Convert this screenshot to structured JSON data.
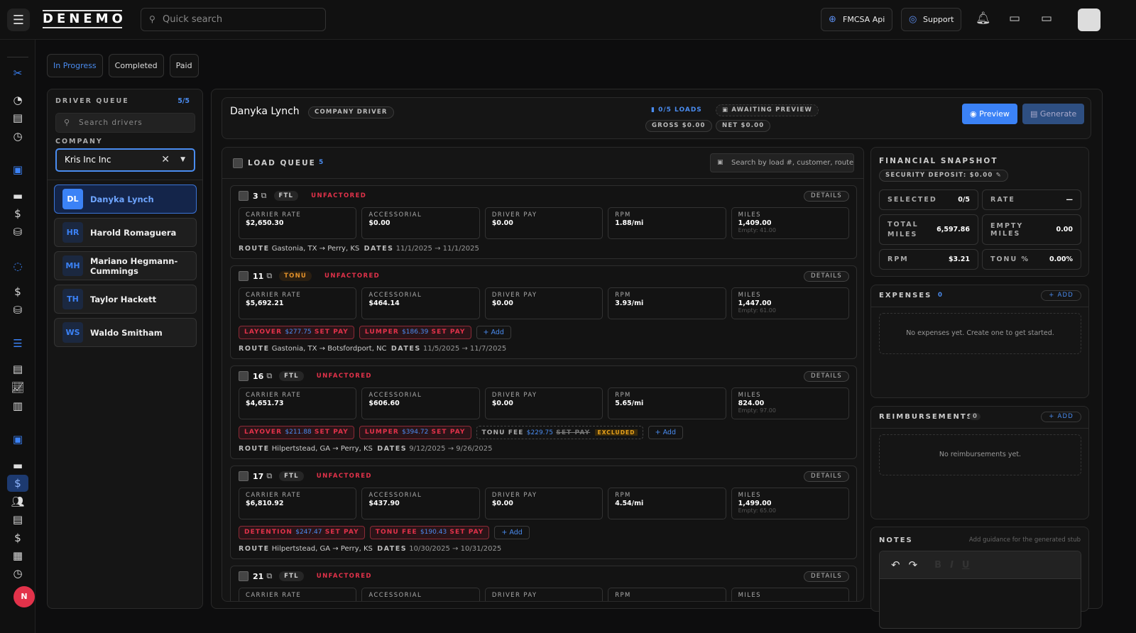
{
  "header": {
    "brand": "DENEMO",
    "search_placeholder": "Quick search",
    "fmcsa_label": "FMCSA Api",
    "support_label": "Support"
  },
  "tabs": [
    {
      "label": "In Progress",
      "active": true
    },
    {
      "label": "Completed",
      "active": false
    },
    {
      "label": "Paid",
      "active": false
    }
  ],
  "driver_queue": {
    "title": "DRIVER QUEUE",
    "count": "5/5",
    "search_placeholder": "Search drivers",
    "company_label": "COMPANY",
    "company_value": "Kris Inc Inc",
    "drivers": [
      {
        "initials": "DL",
        "name": "Danyka Lynch",
        "selected": true
      },
      {
        "initials": "HR",
        "name": "Harold Romaguera",
        "selected": false
      },
      {
        "initials": "MH",
        "name": "Mariano Hegmann-Cummings",
        "selected": false
      },
      {
        "initials": "TH",
        "name": "Taylor Hackett",
        "selected": false
      },
      {
        "initials": "WS",
        "name": "Waldo Smitham",
        "selected": false
      }
    ]
  },
  "driver_header": {
    "name": "Danyka Lynch",
    "role": "COMPANY DRIVER",
    "loads": "0/5 LOADS",
    "status": "AWAITING PREVIEW",
    "gross": "GROSS $0.00",
    "net": "NET $0.00",
    "preview_label": "Preview",
    "generate_label": "Generate"
  },
  "load_queue": {
    "title": "LOAD QUEUE",
    "count": "5",
    "search_placeholder": "Search by load #, customer, route",
    "details_label": "DETAILS",
    "add_label": "Add",
    "route_label": "ROUTE",
    "dates_label": "DATES",
    "metric_labels": [
      "CARRIER RATE",
      "ACCESSORIAL",
      "DRIVER PAY",
      "RPM",
      "MILES"
    ],
    "loads": [
      {
        "id": "3",
        "type": "FTL",
        "status": "UNFACTORED",
        "carrier_rate": "$2,650.30",
        "accessorial": "$0.00",
        "driver_pay": "$0.00",
        "rpm": "1.88/mi",
        "miles": "1,409.00",
        "empty": "Empty: 41.00",
        "chips": [],
        "route": "Gastonia, TX → Perry, KS",
        "dates": "11/1/2025 → 11/1/2025"
      },
      {
        "id": "11",
        "type": "TONU",
        "status": "UNFACTORED",
        "carrier_rate": "$5,692.21",
        "accessorial": "$464.14",
        "driver_pay": "$0.00",
        "rpm": "3.93/mi",
        "miles": "1,447.00",
        "empty": "Empty: 61.00",
        "chips": [
          {
            "name": "LAYOVER",
            "amount": "$277.75",
            "action": "SET PAY",
            "excluded": false
          },
          {
            "name": "LUMPER",
            "amount": "$186.39",
            "action": "SET PAY",
            "excluded": false
          }
        ],
        "route": "Gastonia, TX → Botsfordport, NC",
        "dates": "11/5/2025 → 11/7/2025"
      },
      {
        "id": "16",
        "type": "FTL",
        "status": "UNFACTORED",
        "carrier_rate": "$4,651.73",
        "accessorial": "$606.60",
        "driver_pay": "$0.00",
        "rpm": "5.65/mi",
        "miles": "824.00",
        "empty": "Empty: 97.00",
        "chips": [
          {
            "name": "LAYOVER",
            "amount": "$211.88",
            "action": "SET PAY",
            "excluded": false
          },
          {
            "name": "LUMPER",
            "amount": "$394.72",
            "action": "SET PAY",
            "excluded": false
          },
          {
            "name": "TONU FEE",
            "amount": "$229.75",
            "action": "SET PAY",
            "excluded": true,
            "badge": "EXCLUDED"
          }
        ],
        "route": "Hilpertstead, GA → Perry, KS",
        "dates": "9/12/2025 → 9/26/2025"
      },
      {
        "id": "17",
        "type": "FTL",
        "status": "UNFACTORED",
        "carrier_rate": "$6,810.92",
        "accessorial": "$437.90",
        "driver_pay": "$0.00",
        "rpm": "4.54/mi",
        "miles": "1,499.00",
        "empty": "Empty: 65.00",
        "chips": [
          {
            "name": "DETENTION",
            "amount": "$247.47",
            "action": "SET PAY",
            "excluded": false
          },
          {
            "name": "TONU FEE",
            "amount": "$190.43",
            "action": "SET PAY",
            "excluded": false
          }
        ],
        "route": "Hilpertstead, GA → Perry, KS",
        "dates": "10/30/2025 → 10/31/2025"
      },
      {
        "id": "21",
        "type": "FTL",
        "status": "UNFACTORED",
        "carrier_rate": "",
        "accessorial": "",
        "driver_pay": "",
        "rpm": "",
        "miles": "",
        "empty": "",
        "chips": [],
        "route": "",
        "dates": ""
      }
    ]
  },
  "financial": {
    "title": "FINANCIAL SNAPSHOT",
    "security_deposit": "SECURITY DEPOSIT: $0.00",
    "cells": [
      {
        "label": "SELECTED",
        "value": "0/5"
      },
      {
        "label": "RATE",
        "value": "—"
      },
      {
        "label": "TOTAL MILES",
        "value": "6,597.86"
      },
      {
        "label": "EMPTY MILES",
        "value": "0.00"
      },
      {
        "label": "RPM",
        "value": "$3.21"
      },
      {
        "label": "TONU %",
        "value": "0.00%"
      }
    ]
  },
  "expenses": {
    "title": "EXPENSES",
    "count": "0",
    "add_label": "+ ADD",
    "empty": "No expenses yet. Create one to get started."
  },
  "reimbursements": {
    "title": "REIMBURSEMENTS",
    "count": "0",
    "add_label": "+ ADD",
    "empty": "No reimbursements yet."
  },
  "notes": {
    "title": "NOTES",
    "hint": "Add guidance for the generated stub"
  },
  "colors": {
    "accent": "#3b82f6",
    "danger": "#e2324a",
    "warning": "#e7a21c",
    "bg": "#0d0d0e",
    "panel": "#151515"
  }
}
